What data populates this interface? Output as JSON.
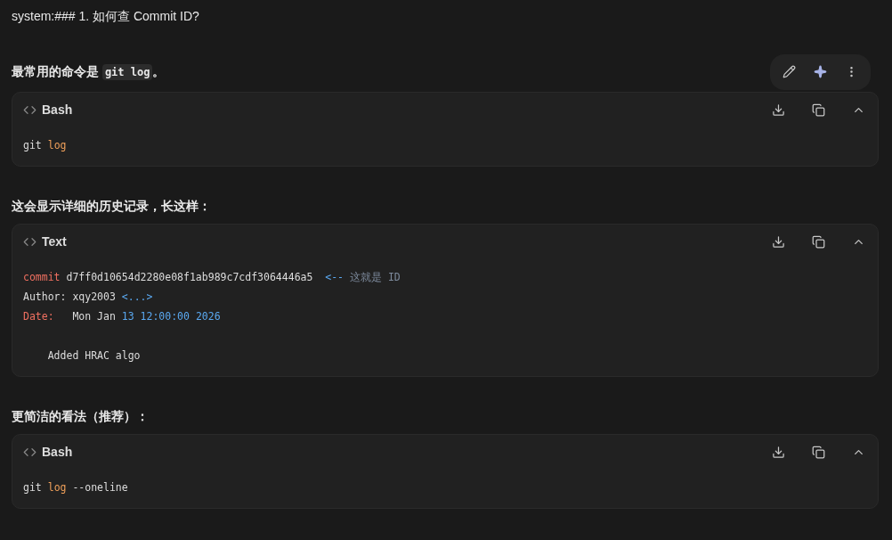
{
  "heading": "system:### 1. 如何查 Commit ID?",
  "blocks": [
    {
      "kind": "paragraph",
      "parts": [
        {
          "text": "最常用的命令是 ",
          "kind": "plain"
        },
        {
          "text": "git log",
          "kind": "code"
        },
        {
          "text": "。",
          "kind": "plain"
        }
      ],
      "toolbar": true
    },
    {
      "kind": "code",
      "language": "Bash",
      "lines": [
        [
          {
            "text": "git ",
            "kind": "plain"
          },
          {
            "text": "log",
            "kind": "keyword"
          }
        ]
      ]
    },
    {
      "kind": "paragraph",
      "parts": [
        {
          "text": "这会显示详细的历史记录，长这样：",
          "kind": "plain"
        }
      ]
    },
    {
      "kind": "code",
      "language": "Text",
      "lines": [
        [
          {
            "text": "commit",
            "kind": "label"
          },
          {
            "text": " d7ff0d10654d2280e08f1ab989c7cdf3064446a5  ",
            "kind": "plain"
          },
          {
            "text": "<--",
            "kind": "number"
          },
          {
            "text": " 这就是 ID",
            "kind": "comment"
          }
        ],
        [
          {
            "text": "Author: xqy2003 ",
            "kind": "plain"
          },
          {
            "text": "<...>",
            "kind": "number"
          }
        ],
        [
          {
            "text": "Date:",
            "kind": "label"
          },
          {
            "text": "   Mon Jan ",
            "kind": "plain"
          },
          {
            "text": "13 12:00:00 2026",
            "kind": "number"
          }
        ],
        {
          "kind": "blank"
        },
        [
          {
            "text": "    Added HRAC algo",
            "kind": "plain"
          }
        ]
      ]
    },
    {
      "kind": "paragraph",
      "parts": [
        {
          "text": "更简洁的看法（推荐）：",
          "kind": "plain"
        }
      ]
    },
    {
      "kind": "code",
      "language": "Bash",
      "lines": [
        [
          {
            "text": "git ",
            "kind": "plain"
          },
          {
            "text": "log",
            "kind": "keyword"
          },
          {
            "text": " --oneline",
            "kind": "plain"
          }
        ]
      ]
    }
  ]
}
